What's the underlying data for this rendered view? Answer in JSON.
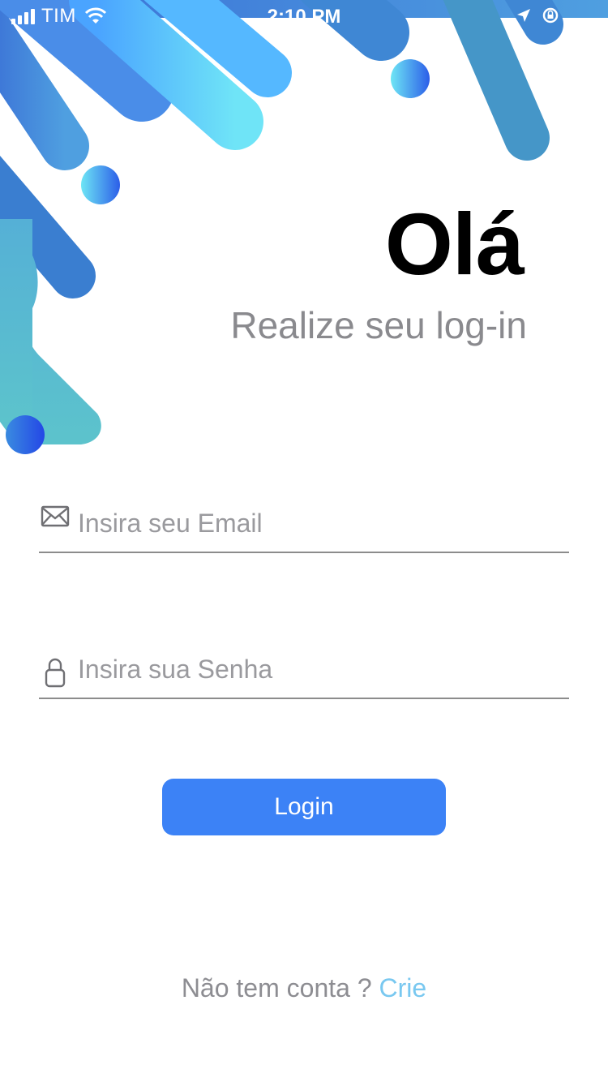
{
  "status_bar": {
    "carrier": "TIM",
    "time": "2:10 PM"
  },
  "header": {
    "greeting": "Olá",
    "subtitle": "Realize seu log-in"
  },
  "form": {
    "email_placeholder": "Insira seu Email",
    "password_placeholder": "Insira sua Senha",
    "login_label": "Login"
  },
  "footer": {
    "prompt": "Não tem conta ?",
    "link_label": "Crie"
  },
  "colors": {
    "primary_button": "#3c82f6",
    "link": "#79c8f0",
    "blob_blue": "#3d7fdc",
    "blob_cyan": "#6fe2f7",
    "blob_teal": "#5abfcb"
  },
  "icons": [
    "signal-icon",
    "wifi-icon",
    "location-icon",
    "lock-rotation-icon",
    "mail-icon",
    "lock-icon"
  ]
}
